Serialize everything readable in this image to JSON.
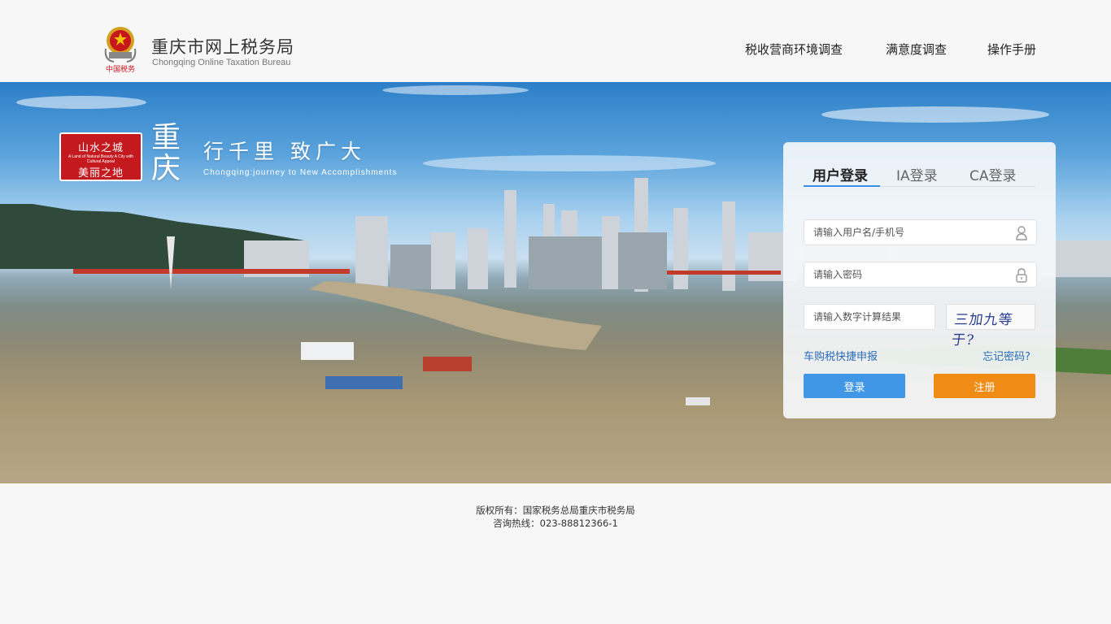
{
  "header": {
    "title": "重庆市网上税务局",
    "subtitle": "Chongqing Online Taxation Bureau",
    "emblem_caption": "中国税务",
    "nav": [
      "税收营商环境调查",
      "满意度调查",
      "操作手册"
    ]
  },
  "banner": {
    "seal_line1": "山水之城",
    "seal_en": "A Land of Natural Beauty A City with Cultural Appeal",
    "seal_line2": "美丽之地",
    "city_calligraphy": "重庆",
    "slogan_calligraphy": "行千里 致广大",
    "slogan_en": "Chongqing:journey to New Accomplishments"
  },
  "login": {
    "tabs": [
      "用户登录",
      "IA登录",
      "CA登录"
    ],
    "active_tab": "用户登录",
    "username_placeholder": "请输入用户名/手机号",
    "password_placeholder": "请输入密码",
    "captcha_placeholder": "请输入数字计算结果",
    "captcha_text": "三加九等于?",
    "vehicle_tax_link": "车购税快捷申报",
    "forgot_password_link": "忘记密码?",
    "login_button": "登录",
    "register_button": "注册",
    "accent_color": "#3f97e5",
    "register_color": "#f08c16"
  },
  "footer": {
    "copyright": "版权所有：国家税务总局重庆市税务局",
    "hotline": "咨询热线：023-88812366-1"
  }
}
